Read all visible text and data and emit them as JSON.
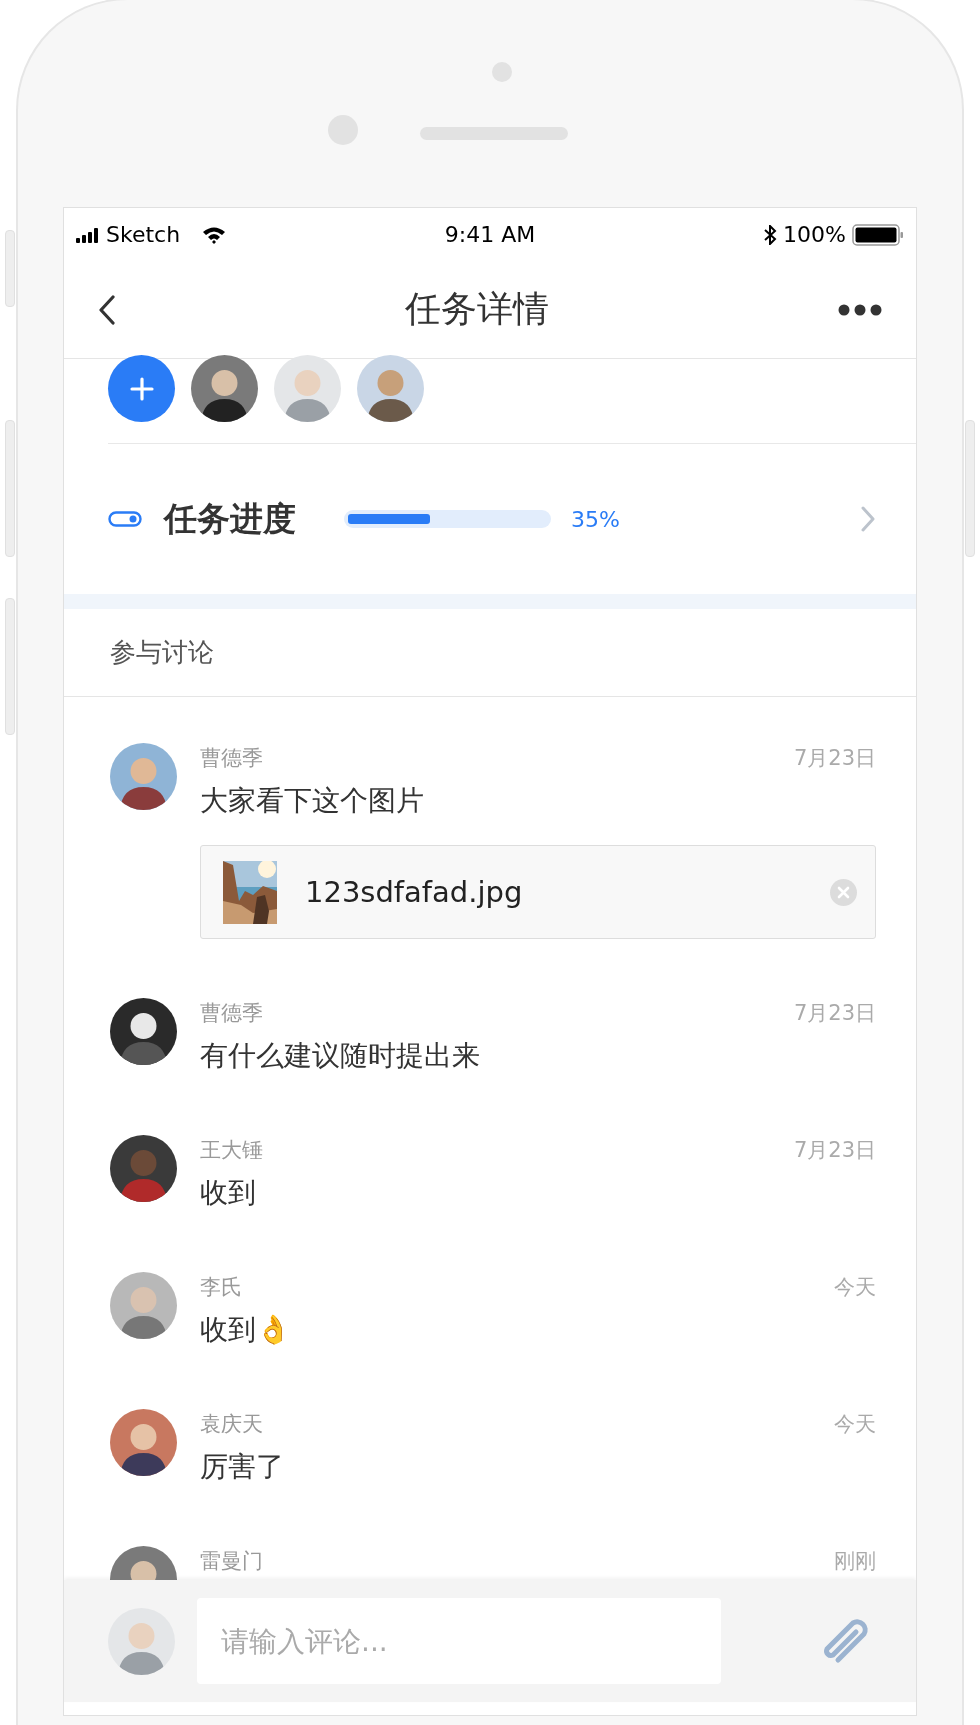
{
  "status_bar": {
    "carrier": "Sketch",
    "time": "9:41 AM",
    "battery": "100%"
  },
  "nav": {
    "title": "任务详情"
  },
  "members": [
    {
      "kind": "add"
    },
    {
      "kind": "picture"
    },
    {
      "kind": "picture"
    },
    {
      "kind": "picture"
    }
  ],
  "progress": {
    "title": "任务进度",
    "level": 0.41,
    "reading": "35%"
  },
  "discussion": {
    "title": "参与讨论",
    "comments": [
      {
        "name": "曹德季",
        "time": "7月23日",
        "text": "大家看下这个图片",
        "attachment": {
          "file": "123sdfafad.jpg"
        }
      },
      {
        "name": "曹德季",
        "time": "7月23日",
        "text": "有什么建议随时提出来"
      },
      {
        "name": "王大锤",
        "time": "7月23日",
        "text": "收到"
      },
      {
        "name": "李氏",
        "time": "今天",
        "text": "收到👌"
      },
      {
        "name": "袁庆天",
        "time": "今天",
        "text": "厉害了"
      },
      {
        "name": "雷曼门",
        "time": "刚刚"
      }
    ]
  },
  "composer": {
    "placeholder": "请输入评论..."
  }
}
